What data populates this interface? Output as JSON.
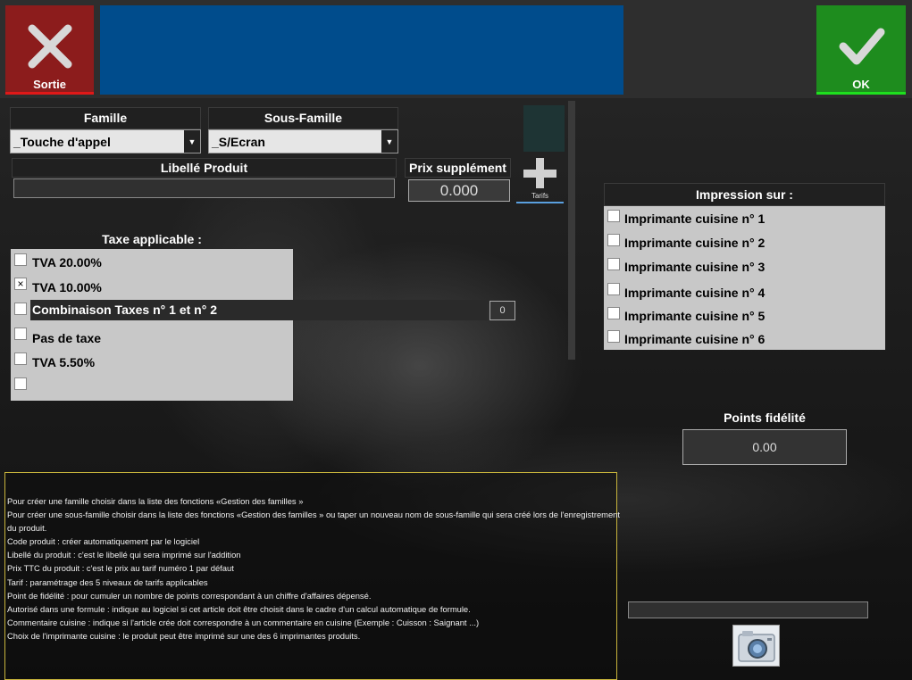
{
  "header": {
    "exit_label": "Sortie",
    "ok_label": "OK"
  },
  "famille": {
    "label": "Famille",
    "value": "_Touche d'appel"
  },
  "sous_famille": {
    "label": "Sous-Famille",
    "value": "_S/Ecran"
  },
  "libelle": {
    "label": "Libellé Produit",
    "value": ""
  },
  "prix": {
    "label": "Prix supplément",
    "value": "0.000"
  },
  "tarifs_label": "Tarifs",
  "taxe": {
    "label": "Taxe applicable :",
    "options": [
      {
        "label": "TVA 20.00%",
        "checked": false
      },
      {
        "label": "TVA 10.00%",
        "checked": true
      },
      {
        "label": "Combinaison Taxes n° 1 et n° 2",
        "checked": false
      },
      {
        "label": "Pas de taxe",
        "checked": false
      },
      {
        "label": "TVA 5.50%",
        "checked": false
      },
      {
        "label": "",
        "checked": false
      }
    ],
    "combinaison_value": "0",
    "check_mark": "×"
  },
  "impression": {
    "label": "Impression sur :",
    "printers": [
      "Imprimante cuisine n° 1",
      "Imprimante cuisine n° 2",
      "Imprimante cuisine n° 3",
      "Imprimante cuisine n° 4",
      "Imprimante cuisine n° 5",
      "Imprimante cuisine n° 6"
    ]
  },
  "points": {
    "label": "Points fidélité",
    "value": "0.00"
  },
  "bottom_field": {
    "value": ""
  },
  "info_lines": [
    "Pour créer une famille choisir dans la liste des fonctions «Gestion des familles »",
    "Pour créer une sous-famille choisir dans la liste des fonctions «Gestion des familles » ou taper un nouveau nom de sous-famille qui sera créé lors de l'enregistrement",
    "du produit.",
    "Code produit : créer automatiquement par le logiciel",
    "Libellé du produit : c'est le libellé qui sera imprimé sur l'addition",
    "Prix TTC du produit : c'est le prix au tarif numéro 1 par défaut",
    "Tarif : paramétrage des 5 niveaux de tarifs applicables",
    "Point de fidélité : pour cumuler un nombre de points correspondant à un chiffre d'affaires dépensé.",
    "Autorisé dans une formule : indique au logiciel si cet article doit être choisit dans le cadre d'un calcul automatique de formule.",
    "Commentaire cuisine : indique si l'article crée doit correspondre à un commentaire en cuisine (Exemple : Cuisson : Saignant ...)",
    "Choix de l'imprimante cuisine : le produit peut être imprimé sur une des 6 imprimantes produits."
  ],
  "colors": {
    "exit": "#8c1c1c",
    "ok": "#1e8c1e",
    "title_bar": "#004c8c"
  }
}
